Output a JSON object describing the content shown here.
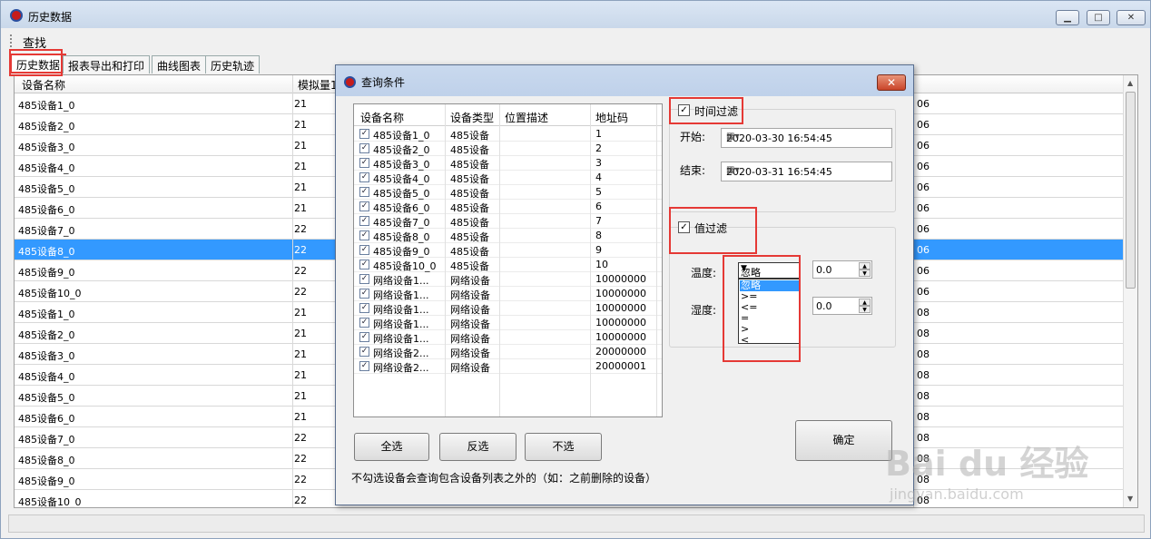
{
  "window": {
    "title": "历史数据",
    "min": "▁",
    "max": "□",
    "close": "✕"
  },
  "menu": {
    "find": "查找"
  },
  "tabs": [
    {
      "label": "历史数据",
      "active": true
    },
    {
      "label": "报表导出和打印"
    },
    {
      "label": "曲线图表"
    },
    {
      "label": "历史轨迹"
    }
  ],
  "grid": {
    "headers": [
      "设备名称",
      "模拟量1"
    ],
    "rows": [
      [
        "485设备1_0",
        "21",
        "06"
      ],
      [
        "485设备2_0",
        "21",
        "06"
      ],
      [
        "485设备3_0",
        "21",
        "06"
      ],
      [
        "485设备4_0",
        "21",
        "06"
      ],
      [
        "485设备5_0",
        "21",
        "06"
      ],
      [
        "485设备6_0",
        "21",
        "06"
      ],
      [
        "485设备7_0",
        "22",
        "06"
      ],
      [
        "485设备8_0",
        "22",
        "06"
      ],
      [
        "485设备9_0",
        "22",
        "06"
      ],
      [
        "485设备10_0",
        "22",
        "06"
      ],
      [
        "485设备1_0",
        "21",
        "08"
      ],
      [
        "485设备2_0",
        "21",
        "08"
      ],
      [
        "485设备3_0",
        "21",
        "08"
      ],
      [
        "485设备4_0",
        "21",
        "08"
      ],
      [
        "485设备5_0",
        "21",
        "08"
      ],
      [
        "485设备6_0",
        "21",
        "08"
      ],
      [
        "485设备7_0",
        "22",
        "08"
      ],
      [
        "485设备8_0",
        "22",
        "08"
      ],
      [
        "485设备9_0",
        "22",
        "08"
      ],
      [
        "485设备10_0",
        "22",
        "08"
      ]
    ],
    "selected_row": 7
  },
  "dialog": {
    "title": "查询条件",
    "close": "✕",
    "list_headers": [
      "设备名称",
      "设备类型",
      "位置描述",
      "地址码"
    ],
    "devices": [
      [
        "485设备1_0",
        "485设备",
        "",
        "1"
      ],
      [
        "485设备2_0",
        "485设备",
        "",
        "2"
      ],
      [
        "485设备3_0",
        "485设备",
        "",
        "3"
      ],
      [
        "485设备4_0",
        "485设备",
        "",
        "4"
      ],
      [
        "485设备5_0",
        "485设备",
        "",
        "5"
      ],
      [
        "485设备6_0",
        "485设备",
        "",
        "6"
      ],
      [
        "485设备7_0",
        "485设备",
        "",
        "7"
      ],
      [
        "485设备8_0",
        "485设备",
        "",
        "8"
      ],
      [
        "485设备9_0",
        "485设备",
        "",
        "9"
      ],
      [
        "485设备10_0",
        "485设备",
        "",
        "10"
      ],
      [
        "网络设备1...",
        "网络设备",
        "",
        "10000000"
      ],
      [
        "网络设备1...",
        "网络设备",
        "",
        "10000000"
      ],
      [
        "网络设备1...",
        "网络设备",
        "",
        "10000000"
      ],
      [
        "网络设备1...",
        "网络设备",
        "",
        "10000000"
      ],
      [
        "网络设备1...",
        "网络设备",
        "",
        "10000000"
      ],
      [
        "网络设备2...",
        "网络设备",
        "",
        "20000000"
      ],
      [
        "网络设备2...",
        "网络设备",
        "",
        "20000001"
      ]
    ],
    "btn_all": "全选",
    "btn_invert": "反选",
    "btn_none": "不选",
    "note": "不勾选设备会查询包含设备列表之外的（如：之前删除的设备）",
    "time_filter": {
      "label": "时间过滤",
      "checked": true,
      "start_label": "开始:",
      "start_value": "2020-03-30  16:54:45",
      "end_label": "结束:",
      "end_value": "2020-03-31  16:54:45"
    },
    "value_filter": {
      "label": "值过滤",
      "checked": true,
      "temp_label": "温度:",
      "humid_label": "湿度:",
      "temp_op": "忽略",
      "temp_value": "0.0",
      "humid_value": "0.0",
      "ops": [
        "忽略",
        ">=",
        "<=",
        "=",
        ">",
        "<"
      ]
    },
    "ok": "确定"
  },
  "watermark": {
    "main": "Bai du 经验",
    "sub": "jingyan.baidu.com"
  }
}
